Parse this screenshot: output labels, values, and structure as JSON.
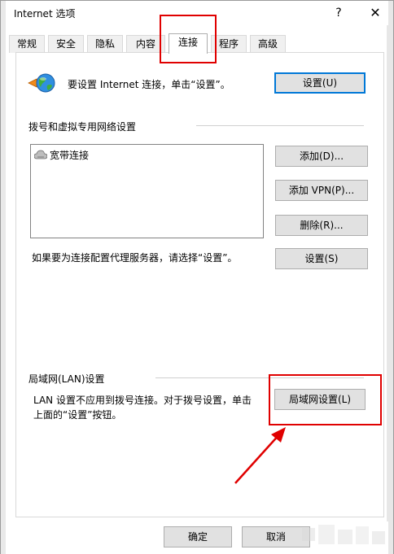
{
  "window": {
    "title": "Internet 选项",
    "help_glyph": "?",
    "close_glyph": "✕"
  },
  "tabs": [
    {
      "label": "常规"
    },
    {
      "label": "安全"
    },
    {
      "label": "隐私"
    },
    {
      "label": "内容"
    },
    {
      "label": "连接"
    },
    {
      "label": "程序"
    },
    {
      "label": "高级"
    }
  ],
  "active_tab": "连接",
  "connect": {
    "prompt": "要设置 Internet 连接，单击“设置”。",
    "setup_button": "设置(U)"
  },
  "dialup": {
    "section_title": "拨号和虚拟专用网络设置",
    "connections": [
      {
        "name": "宽带连接"
      }
    ],
    "add_button": "添加(D)...",
    "add_vpn_button": "添加 VPN(P)...",
    "remove_button": "删除(R)...",
    "proxy_hint": "如果要为连接配置代理服务器，请选择“设置”。",
    "settings_button": "设置(S)"
  },
  "lan": {
    "section_title": "局域网(LAN)设置",
    "note_line1": "LAN 设置不应用到拨号连接。对于拨号设置，单击",
    "note_line2": "上面的“设置”按钮。",
    "lan_button": "局域网设置(L)"
  },
  "footer": {
    "ok_button": "确定",
    "cancel_button": "取消"
  },
  "annotation": {
    "highlight_color": "#e00000"
  }
}
